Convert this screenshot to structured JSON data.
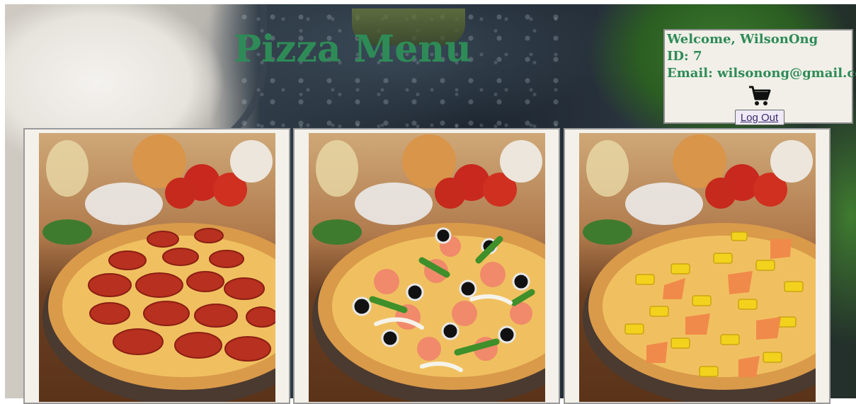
{
  "page": {
    "title": "Pizza Menu"
  },
  "user": {
    "welcome": "Welcome, WilsonOng",
    "id": "ID: 7",
    "email": "Email: wilsonong@gmail.com",
    "cart_icon": "shopping-cart-icon",
    "logout_label": "Log Out"
  },
  "menu": {
    "items": [
      {
        "topping": "pepperoni"
      },
      {
        "topping": "supreme"
      },
      {
        "topping": "hawaiian"
      }
    ]
  },
  "colors": {
    "title": "#2e8b57",
    "panel": "#f1efe8"
  }
}
